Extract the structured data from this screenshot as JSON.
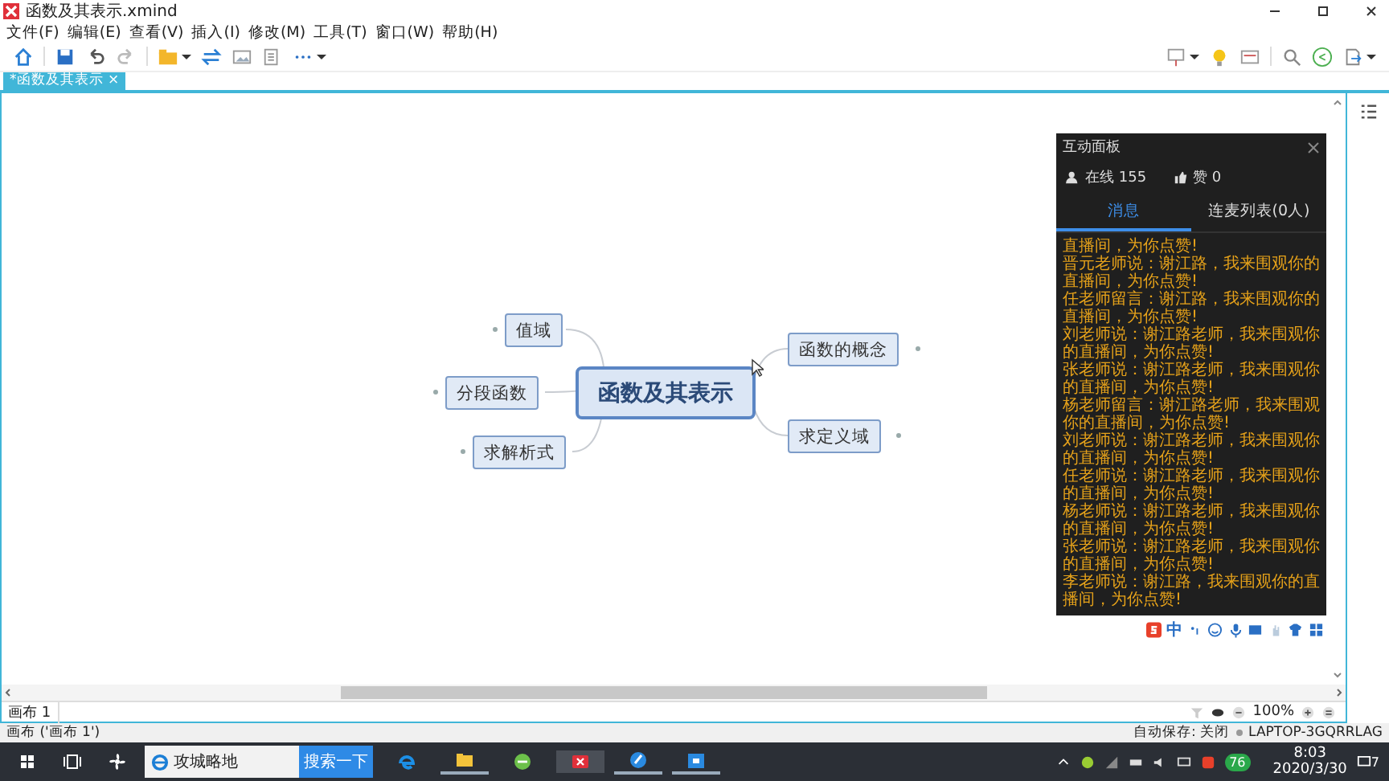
{
  "window": {
    "title": "函数及其表示.xmind"
  },
  "menu": [
    "文件(F)",
    "编辑(E)",
    "查看(V)",
    "插入(I)",
    "修改(M)",
    "工具(T)",
    "窗口(W)",
    "帮助(H)"
  ],
  "tab": {
    "label": "*函数及其表示",
    "close": "×"
  },
  "mindmap": {
    "central": "函数及其表示",
    "left_topics": [
      {
        "label": "值域"
      },
      {
        "label": "分段函数"
      },
      {
        "label": "求解析式"
      }
    ],
    "right_topics": [
      {
        "label": "函数的概念"
      },
      {
        "label": "求定义域"
      }
    ]
  },
  "panel": {
    "title": "互动面板",
    "online": "在线 155",
    "likes": "赞 0",
    "tabs": [
      {
        "label": "消息",
        "selected": true
      },
      {
        "label": "连麦列表(0人)",
        "selected": false
      }
    ],
    "messages": [
      "直播间，为你点赞!",
      "晋元老师说：谢江路，我来围观你的直播间，为你点赞!",
      "任老师留言：谢江路，我来围观你的直播间，为你点赞!",
      "刘老师说：谢江路老师，我来围观你的直播间，为你点赞!",
      "张老师说：谢江路老师，我来围观你的直播间，为你点赞!",
      "杨老师留言：谢江路老师，我来围观你的直播间，为你点赞!",
      "刘老师说：谢江路老师，我来围观你的直播间，为你点赞!",
      "任老师说：谢江路老师，我来围观你的直播间，为你点赞!",
      "杨老师说：谢江路老师，我来围观你的直播间，为你点赞!",
      "张老师说：谢江路老师，我来围观你的直播间，为你点赞!",
      "李老师说：谢江路，我来围观你的直播间，为你点赞!"
    ]
  },
  "ime": {
    "mode": "中"
  },
  "sheet_tab": "画布 1",
  "zoom": "100%",
  "status_bar": {
    "left": "画布 ('画布 1')",
    "autosave": "自动保存: 关闭",
    "computer": "LAPTOP-3GQRRLAG"
  },
  "taskbar": {
    "search_value": "攻城略地",
    "search_button": "搜索一下",
    "badge": "76",
    "time": "8:03",
    "date": "2020/3/30",
    "notifications": "7"
  }
}
